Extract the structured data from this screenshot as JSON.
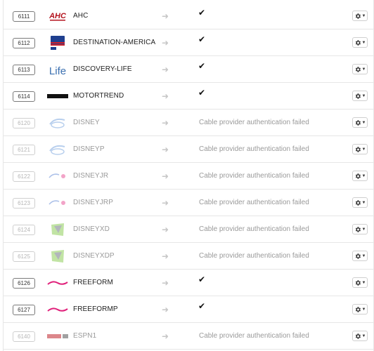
{
  "channels": [
    {
      "number": "6111",
      "name": "AHC",
      "logo": "ahc-logo",
      "status": "ok",
      "enabled": true
    },
    {
      "number": "6112",
      "name": "DESTINATION-AMERICA",
      "logo": "destination-america-logo",
      "status": "ok",
      "enabled": true
    },
    {
      "number": "6113",
      "name": "DISCOVERY-LIFE",
      "logo": "discovery-life-logo",
      "status": "ok",
      "enabled": true
    },
    {
      "number": "6114",
      "name": "MOTORTREND",
      "logo": "motortrend-logo",
      "status": "ok",
      "enabled": true
    },
    {
      "number": "6120",
      "name": "DISNEY",
      "logo": "disney-channel-logo",
      "status": "Cable provider authentication failed",
      "enabled": false
    },
    {
      "number": "6121",
      "name": "DISNEYP",
      "logo": "disney-channel-logo",
      "status": "Cable provider authentication failed",
      "enabled": false
    },
    {
      "number": "6122",
      "name": "DISNEYJR",
      "logo": "disney-junior-logo",
      "status": "Cable provider authentication failed",
      "enabled": false
    },
    {
      "number": "6123",
      "name": "DISNEYJRP",
      "logo": "disney-junior-logo",
      "status": "Cable provider authentication failed",
      "enabled": false
    },
    {
      "number": "6124",
      "name": "DISNEYXD",
      "logo": "disney-xd-logo",
      "status": "Cable provider authentication failed",
      "enabled": false
    },
    {
      "number": "6125",
      "name": "DISNEYXDP",
      "logo": "disney-xd-logo",
      "status": "Cable provider authentication failed",
      "enabled": false
    },
    {
      "number": "6126",
      "name": "FREEFORM",
      "logo": "freeform-logo",
      "status": "ok",
      "enabled": true
    },
    {
      "number": "6127",
      "name": "FREEFORMP",
      "logo": "freeform-logo",
      "status": "ok",
      "enabled": true
    },
    {
      "number": "6140",
      "name": "ESPN1",
      "logo": "espn-hd-logo",
      "status": "Cable provider authentication failed",
      "enabled": false
    }
  ],
  "icons": {
    "arrow": "arrow-right-icon",
    "check": "checkmark-icon",
    "gear": "gear-icon",
    "caret": "caret-down-icon"
  },
  "colors": {
    "check": "#111111",
    "muted_text": "#9a9a9a",
    "border": "#e6e6e6"
  }
}
